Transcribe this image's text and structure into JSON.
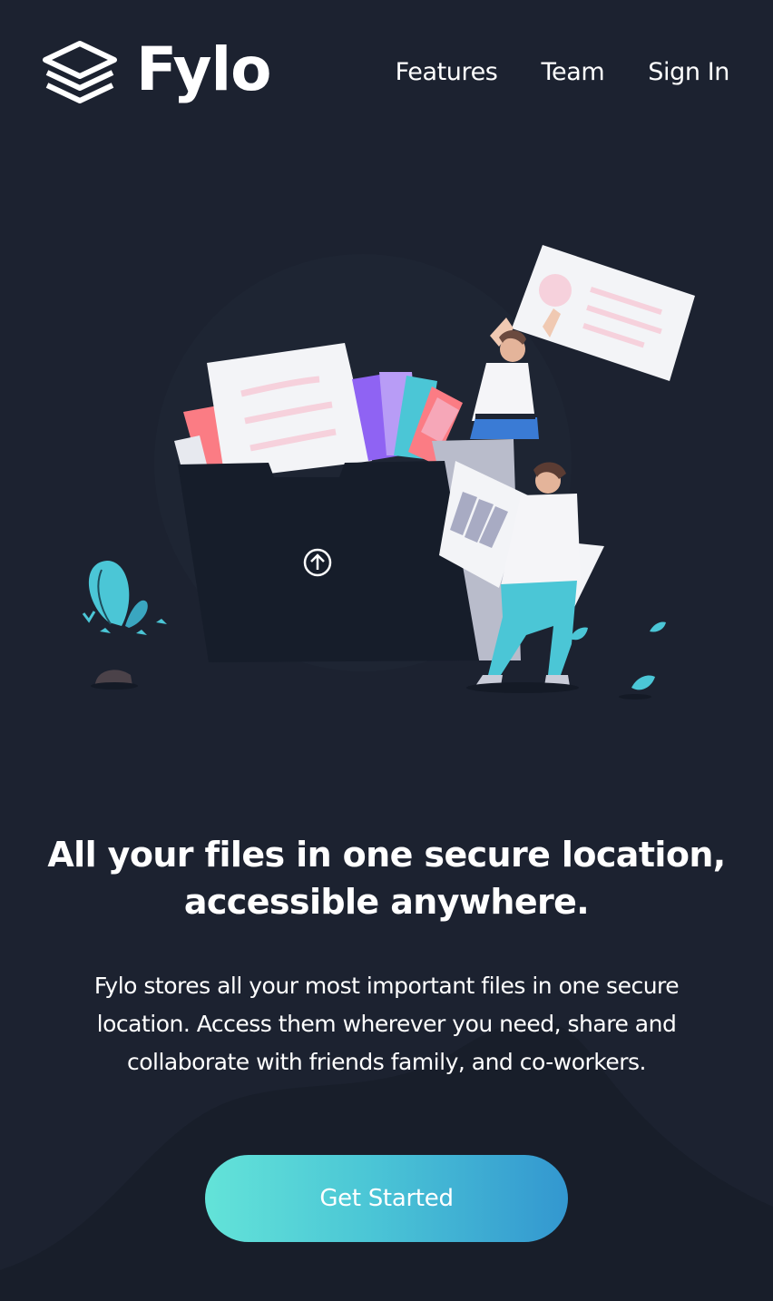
{
  "header": {
    "brand": "Fylo",
    "nav": [
      "Features",
      "Team",
      "Sign In"
    ]
  },
  "hero": {
    "title": "All your files in one secure location, accessible anywhere.",
    "description": "Fylo stores all your most important files in one secure location. Access them wherever you need, share and collaborate with friends family, and co-workers.",
    "cta_label": "Get Started"
  },
  "colors": {
    "background": "#1c2230",
    "background_curve": "#181e2a",
    "cta_gradient_start": "#63e3d8",
    "cta_gradient_end": "#3397d0",
    "text": "#ffffff"
  }
}
